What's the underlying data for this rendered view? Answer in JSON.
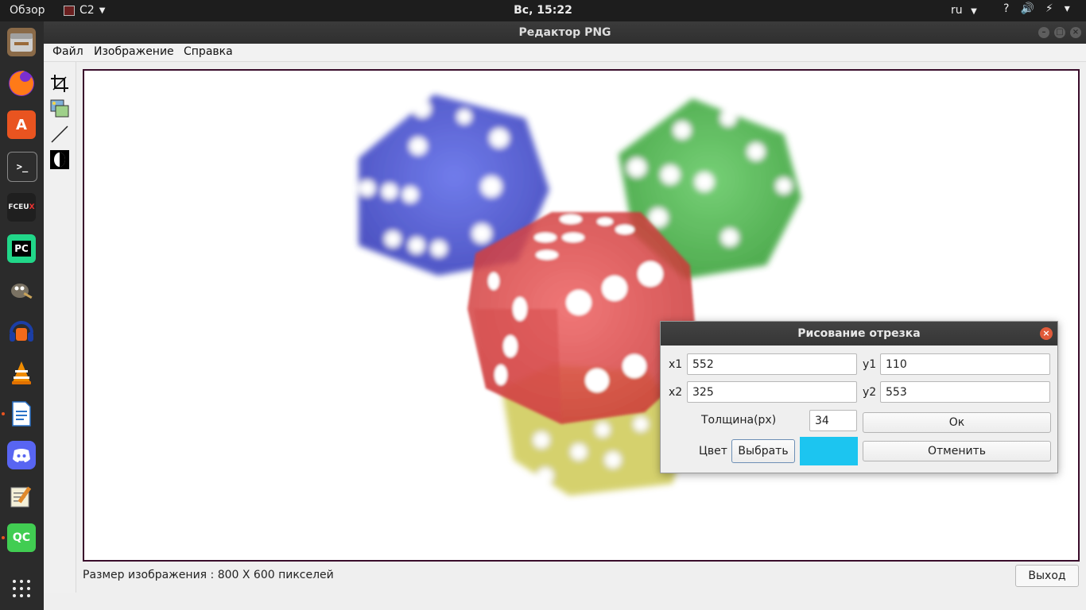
{
  "topbar": {
    "overview": "Обзор",
    "app_name": "C2",
    "clock": "Вс, 15:22",
    "lang": "ru",
    "tray": [
      "?",
      "🔊",
      "⚡",
      "▾"
    ]
  },
  "window": {
    "title": "Редактор PNG"
  },
  "dock": {
    "items": [
      {
        "name": "files",
        "label": "",
        "color": "#7b5c3a"
      },
      {
        "name": "firefox",
        "label": "",
        "color": "#e66000"
      },
      {
        "name": "software",
        "label": "A",
        "color": "#e95420"
      },
      {
        "name": "terminal",
        "label": ">_",
        "color": "#2d2d2d"
      },
      {
        "name": "fceux",
        "label": "FCEUX",
        "color": "#222222"
      },
      {
        "name": "pycharm",
        "label": "PC",
        "color": "#21d789"
      },
      {
        "name": "gimp",
        "label": "",
        "color": "#5c5543"
      },
      {
        "name": "audacity",
        "label": "",
        "color": "#f7a800"
      },
      {
        "name": "vlc",
        "label": "",
        "color": "#f08c00"
      },
      {
        "name": "writer",
        "label": "",
        "color": "#2a72c8"
      },
      {
        "name": "discord",
        "label": "",
        "color": "#5865f2"
      },
      {
        "name": "text-editor",
        "label": "",
        "color": "#f4f0d8"
      },
      {
        "name": "qt-creator",
        "label": "QC",
        "color": "#41cd52"
      }
    ]
  },
  "menu": {
    "items": [
      "Файл",
      "Изображение",
      "Справка"
    ]
  },
  "toolbar": {
    "tools": [
      "crop-icon",
      "image-icon",
      "line-icon",
      "invert-icon"
    ]
  },
  "status": {
    "text": "Размер изображения : 800 X 600 пикселей",
    "exit_label": "Выход"
  },
  "dialog": {
    "title": "Рисование отрезка",
    "x1_label": "x1",
    "x1_value": "552",
    "y1_label": "y1",
    "y1_value": "110",
    "x2_label": "x2",
    "x2_value": "325",
    "y2_label": "y2",
    "y2_value": "553",
    "thickness_label": "Толщина(px)",
    "thickness_value": "34",
    "ok_label": "Ок",
    "color_label": "Цвет",
    "choose_label": "Выбрать",
    "cancel_label": "Отменить",
    "swatch_color": "#1cc5f0"
  }
}
